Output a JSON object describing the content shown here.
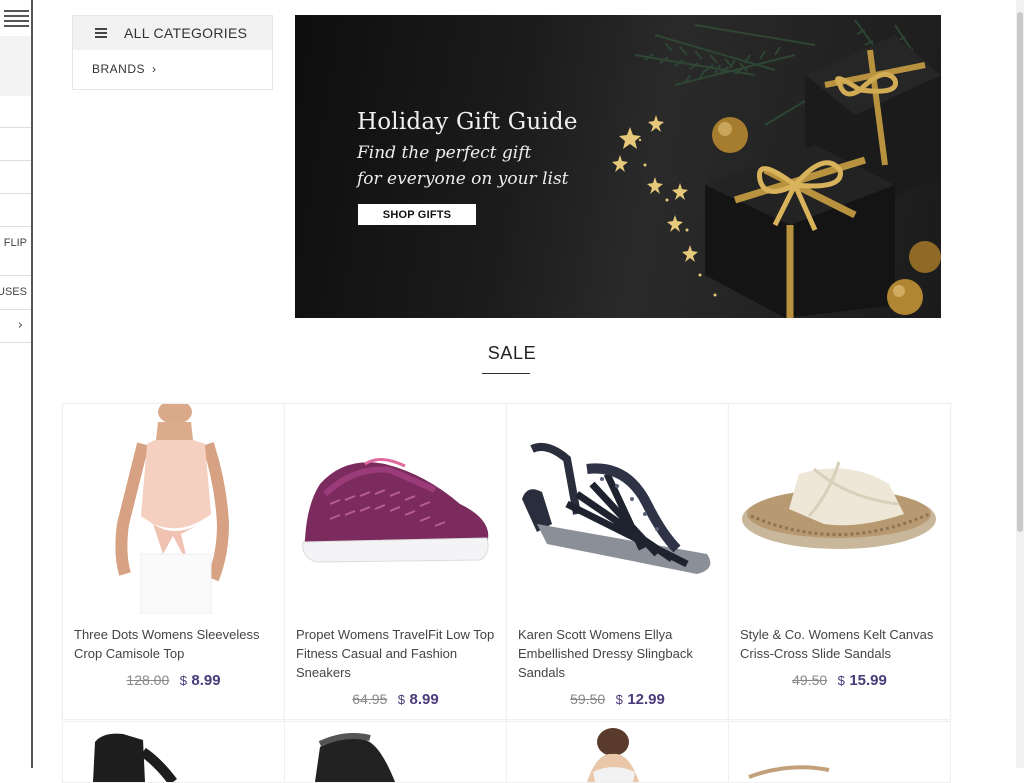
{
  "drawer": {
    "items": [
      {
        "label": ""
      },
      {
        "label": ""
      },
      {
        "label": ""
      },
      {
        "label": "FLIP"
      },
      {
        "label": "USES"
      },
      {
        "label": ""
      }
    ]
  },
  "categories": {
    "title": "ALL CATEGORIES",
    "brands_label": "BRANDS"
  },
  "banner": {
    "title": "Holiday Gift Guide",
    "subtitle_line1": "Find the perfect gift",
    "subtitle_line2": "for everyone on your list",
    "cta_label": "SHOP GIFTS"
  },
  "section": {
    "title": "SALE"
  },
  "products": [
    {
      "name": "Three Dots Womens Sleeveless Crop Camisole Top",
      "old_price": "128.00",
      "currency": "$",
      "price": "8.99"
    },
    {
      "name": "Propet Womens TravelFit Low Top Fitness Casual and Fashion Sneakers",
      "old_price": "64.95",
      "currency": "$",
      "price": "8.99"
    },
    {
      "name": "Karen Scott Womens Ellya Embellished Dressy Slingback Sandals",
      "old_price": "59.50",
      "currency": "$",
      "price": "12.99"
    },
    {
      "name": "Style & Co. Womens Kelt Canvas Criss-Cross Slide Sandals",
      "old_price": "49.50",
      "currency": "$",
      "price": "15.99"
    }
  ],
  "colors": {
    "price_accent": "#4a3b7a",
    "banner_bg": "#1a1a1a",
    "gold": "#c9a24b"
  },
  "icons": {
    "menu": "hamburger-icon",
    "categories": "list-icon",
    "chevron": "chevron-right-icon"
  }
}
